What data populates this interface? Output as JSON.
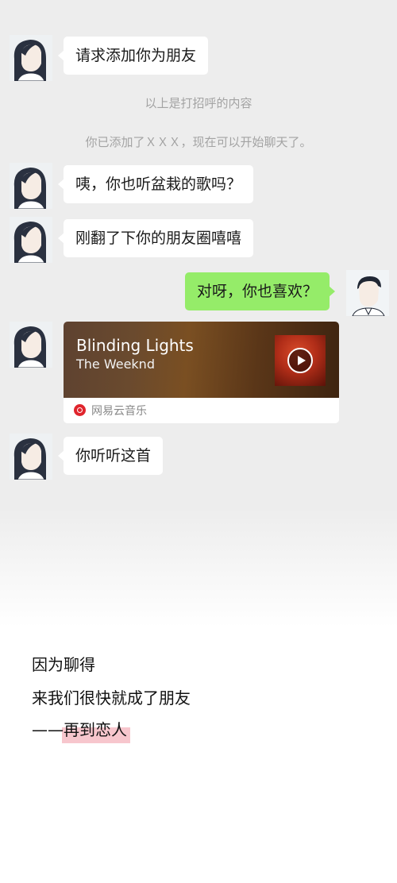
{
  "messages": {
    "greeting": "请求添加你为朋友",
    "sys_greeting_note": "以上是打招呼的内容",
    "sys_added": "你已添加了ＸＸＸ，现在可以开始聊天了。",
    "msg_1": "咦，你也听盆栽的歌吗？",
    "msg_2": "刚翻了下你的朋友圈嘻嘻",
    "reply": "对呀，你也喜欢？",
    "msg_last": "你听听这首"
  },
  "music_card": {
    "song": "Blinding Lights",
    "artist": "The Weeknd",
    "source": "网易云音乐",
    "brand_color": "#e0252d"
  },
  "caption": {
    "line1": "因为聊得",
    "line2": "来我们很快就成了朋友",
    "line3_prefix": "——",
    "line3_highlight": "再到恋人",
    "highlight_color": "#f7c6cd"
  },
  "colors": {
    "chat_bg": "#ededed",
    "outgoing_bubble": "#95ec69",
    "incoming_bubble": "#ffffff"
  }
}
